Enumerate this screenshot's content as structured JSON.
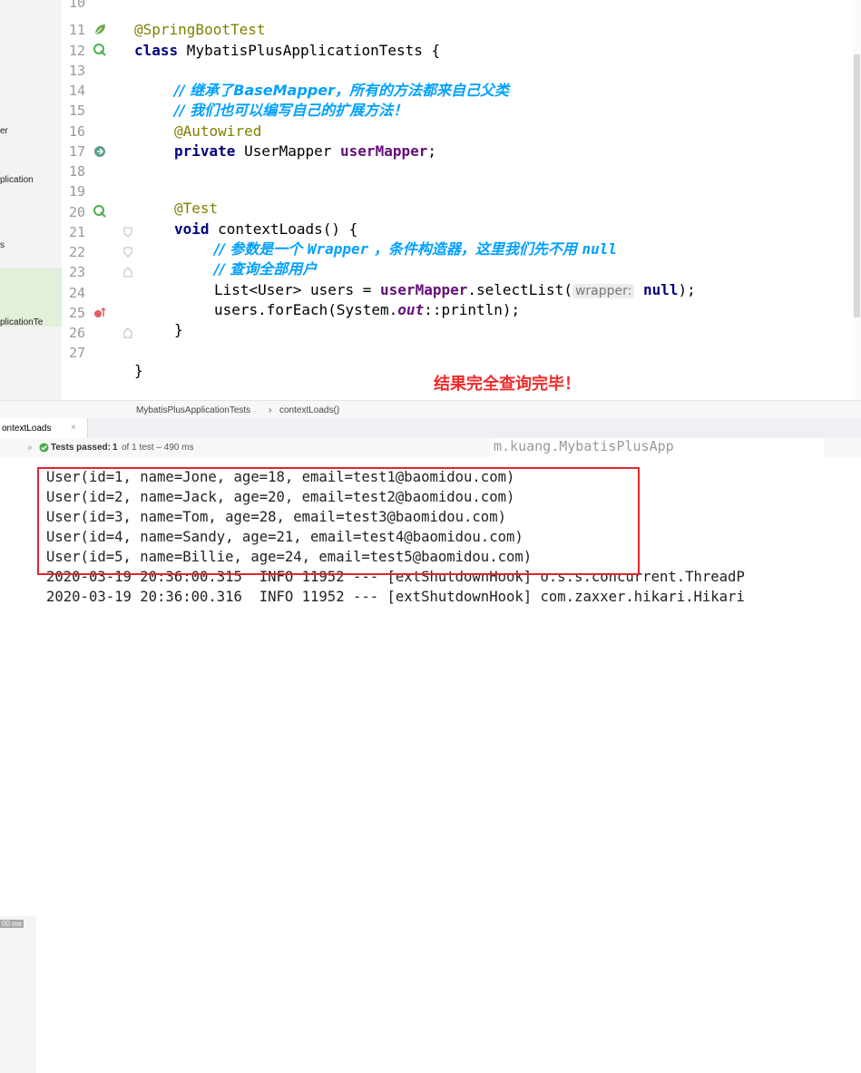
{
  "project_panel": {
    "items": [
      "er",
      "plication",
      "s",
      "plicationTe"
    ]
  },
  "gutter": {
    "line_numbers": [
      "10",
      "11",
      "12",
      "13",
      "14",
      "15",
      "16",
      "17",
      "18",
      "19",
      "20",
      "21",
      "22",
      "23",
      "24",
      "25",
      "26",
      "27"
    ]
  },
  "code": {
    "line11": "@SpringBootTest",
    "line12_kw": "class",
    "line12_rest": " MybatisPlusApplicationTests {",
    "line14": "// 继承了BaseMapper，所有的方法都来自己父类",
    "line15": "// 我们也可以编写自己的扩展方法！",
    "line16": "@Autowired",
    "line17_kw": "private",
    "line17_type": " UserMapper ",
    "line17_field": "userMapper",
    "line17_end": ";",
    "line19": "@Test",
    "line20_kw": "void",
    "line20_rest": " contextLoads() {",
    "line21_a": "// 参数是一个 ",
    "line21_b": "Wrapper",
    "line21_c": " ，条件构造器，这里我们先不用 ",
    "line21_d": "null",
    "line22": "// 查询全部用户",
    "line23_a": "List<User> users = ",
    "line23_field": "userMapper",
    "line23_b": ".selectList(",
    "line23_hint": "wrapper:",
    "line23_null": "null",
    "line23_c": ");",
    "line24_a": "users.forEach(System.",
    "line24_out": "out",
    "line24_b": "::println);",
    "line25": "}",
    "line27": "}"
  },
  "annotation_text": "结果完全查询完毕！",
  "breadcrumb": {
    "class_name": "MybatisPlusApplicationTests",
    "separator": "›",
    "method_name": "contextLoads()"
  },
  "run_tab": {
    "label": "ontextLoads",
    "close": "×"
  },
  "status": {
    "passed_label": "Tests passed:",
    "passed_count": "1",
    "passed_detail": "of 1 test – 490 ms",
    "side_time": "00 ms",
    "top_log_fragment": "m.kuang.MybatisPlusApp"
  },
  "console": {
    "results": [
      "User(id=1, name=Jone, age=18, email=test1@baomidou.com)",
      "User(id=2, name=Jack, age=20, email=test2@baomidou.com)",
      "User(id=3, name=Tom, age=28, email=test3@baomidou.com)",
      "User(id=4, name=Sandy, age=21, email=test4@baomidou.com)",
      "User(id=5, name=Billie, age=24, email=test5@baomidou.com)"
    ],
    "log1": "2020-03-19 20:36:00.315  INFO 11952 --- [extShutdownHook] o.s.s.concurrent.ThreadP",
    "log2": "2020-03-19 20:36:00.316  INFO 11952 --- [extShutdownHook] com.zaxxer.hikari.Hikari"
  },
  "colors": {
    "comment": "#00a0ff",
    "annotation": "#808000",
    "keyword": "#000080",
    "field": "#660e7a",
    "highlight_red": "#e0262d",
    "current_line": "#fffae3"
  }
}
